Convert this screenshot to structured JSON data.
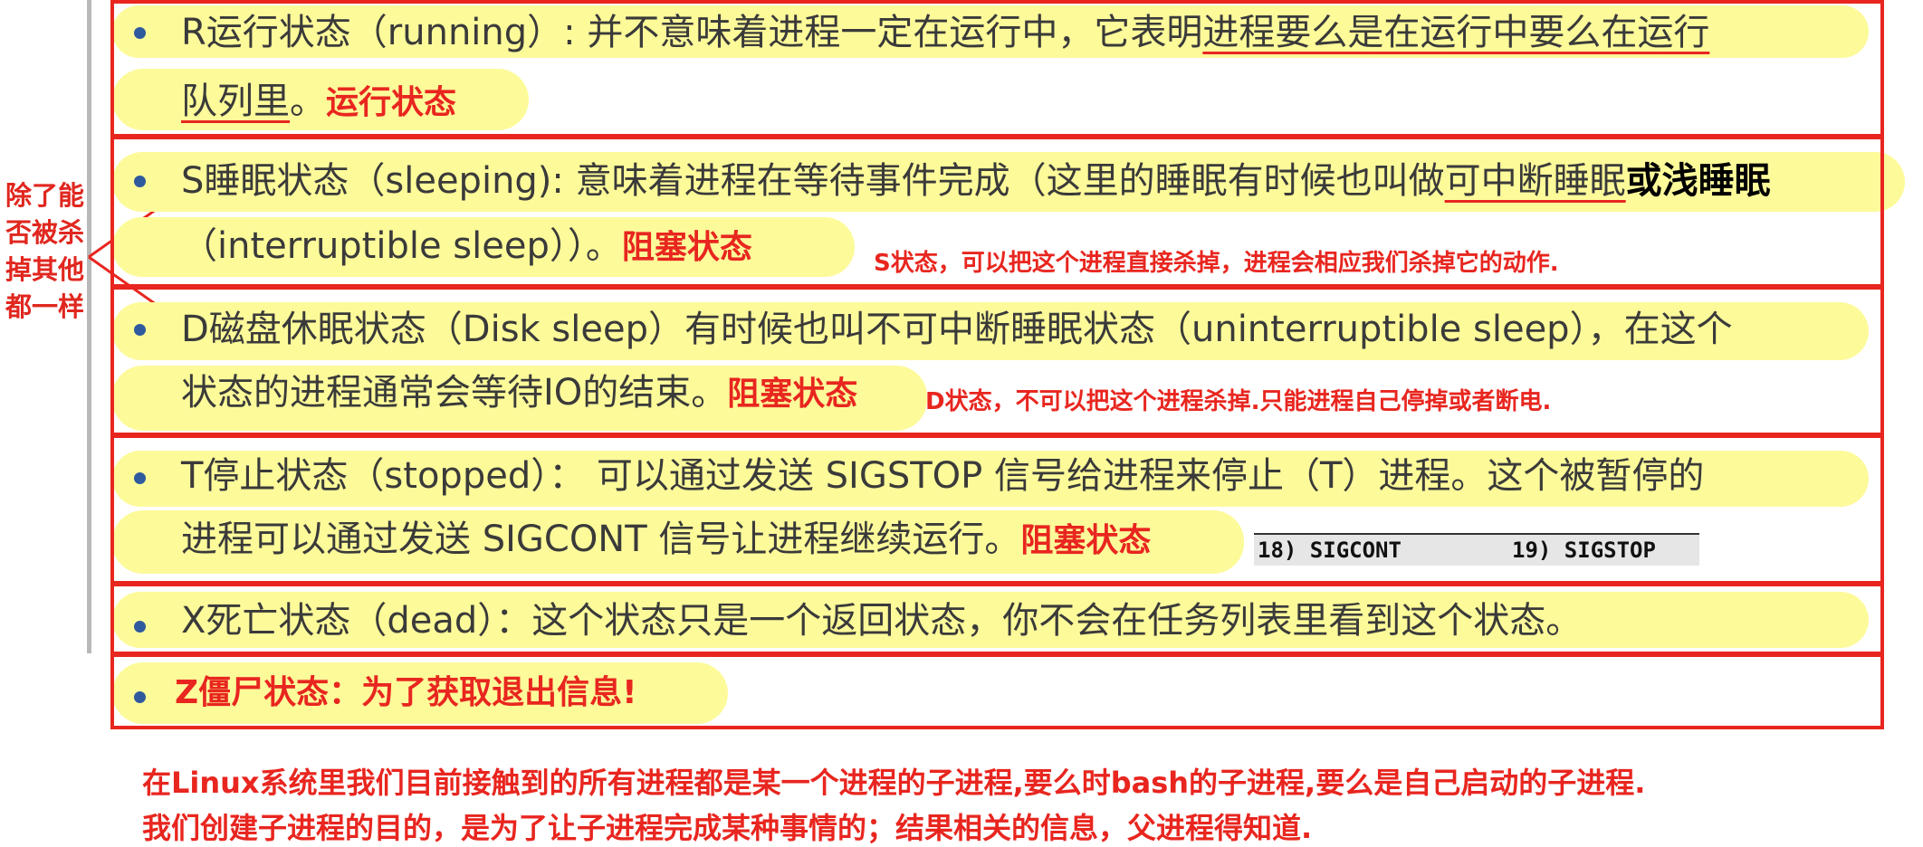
{
  "side_note": [
    "除了能",
    "否被杀",
    "掉其他",
    "都一样"
  ],
  "r_state": {
    "line1_a": "R运行状态（running）: 并不意味着进程一定在运行中，它表明",
    "line1_u": "进程要么是在运行中要么在运行",
    "line2_u": "队列里",
    "line2_b": "。",
    "tag": "运行状态"
  },
  "s_state": {
    "line1_a": "S睡眠状态（sleeping): 意味着进程在等待事件完成（这里的睡眠有时候也叫做",
    "line1_u": "可中断睡眠",
    "line1_bold": "或浅睡眠",
    "line2": "（interruptible sleep））。",
    "tag": "阻塞状态",
    "note": "S状态，可以把这个进程直接杀掉，进程会相应我们杀掉它的动作."
  },
  "d_state": {
    "line1": "D磁盘休眠状态（Disk sleep）有时候也叫不可中断睡眠状态（uninterruptible sleep），在这个",
    "line2": "状态的进程通常会等待IO的结束。",
    "tag": "阻塞状态",
    "note": "D状态，不可以把这个进程杀掉.只能进程自己停掉或者断电."
  },
  "t_state": {
    "line1": "T停止状态（stopped）： 可以通过发送 SIGSTOP 信号给进程来停止（T）进程。这个被暂停的",
    "line2": "进程可以通过发送 SIGCONT 信号让进程继续运行。",
    "tag": "阻塞状态",
    "signals": [
      "18) SIGCONT",
      "19) SIGSTOP"
    ]
  },
  "x_state": {
    "line1": "X死亡状态（dead）：这个状态只是一个返回状态，你不会在任务列表里看到这个状态。"
  },
  "z_state": {
    "line1": "Z僵尸状态：为了获取退出信息!"
  },
  "footer": {
    "line1": "在Linux系统里我们目前接触到的所有进程都是某一个进程的子进程,要么时bash的子进程,要么是自己启动的子进程.",
    "line2": "我们创建子进程的目的，是为了让子进程完成某种事情的；结果相关的信息，父进程得知道."
  }
}
